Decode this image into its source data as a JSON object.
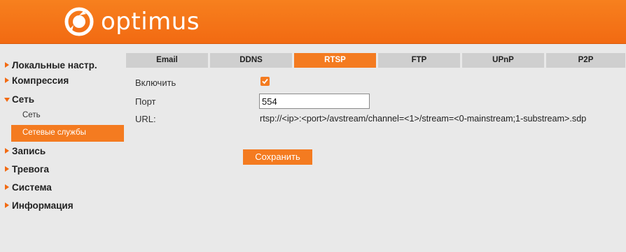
{
  "header": {
    "brand": "optimus",
    "brand_color": "#f47b20"
  },
  "sidebar": {
    "items": [
      {
        "label": "Локальные настр.",
        "expanded": false
      },
      {
        "label": "Компрессия",
        "expanded": false
      },
      {
        "label": "Сеть",
        "expanded": true,
        "children": [
          {
            "label": "Сеть",
            "active": false
          },
          {
            "label": "Сетевые службы",
            "active": true
          }
        ]
      },
      {
        "label": "Запись",
        "expanded": false
      },
      {
        "label": "Тревога",
        "expanded": false
      },
      {
        "label": "Система",
        "expanded": false
      },
      {
        "label": "Информация",
        "expanded": false
      }
    ]
  },
  "tabs": [
    {
      "label": "Email",
      "active": false
    },
    {
      "label": "DDNS",
      "active": false
    },
    {
      "label": "RTSP",
      "active": true
    },
    {
      "label": "FTP",
      "active": false
    },
    {
      "label": "UPnP",
      "active": false
    },
    {
      "label": "P2P",
      "active": false
    }
  ],
  "form": {
    "enable_label": "Включить",
    "enable_checked": true,
    "port_label": "Порт",
    "port_value": "554",
    "url_label": "URL:",
    "url_value": "rtsp://<ip>:<port>/avstream/channel=<1>/stream=<0-mainstream;1-substream>.sdp",
    "save_label": "Сохранить"
  }
}
